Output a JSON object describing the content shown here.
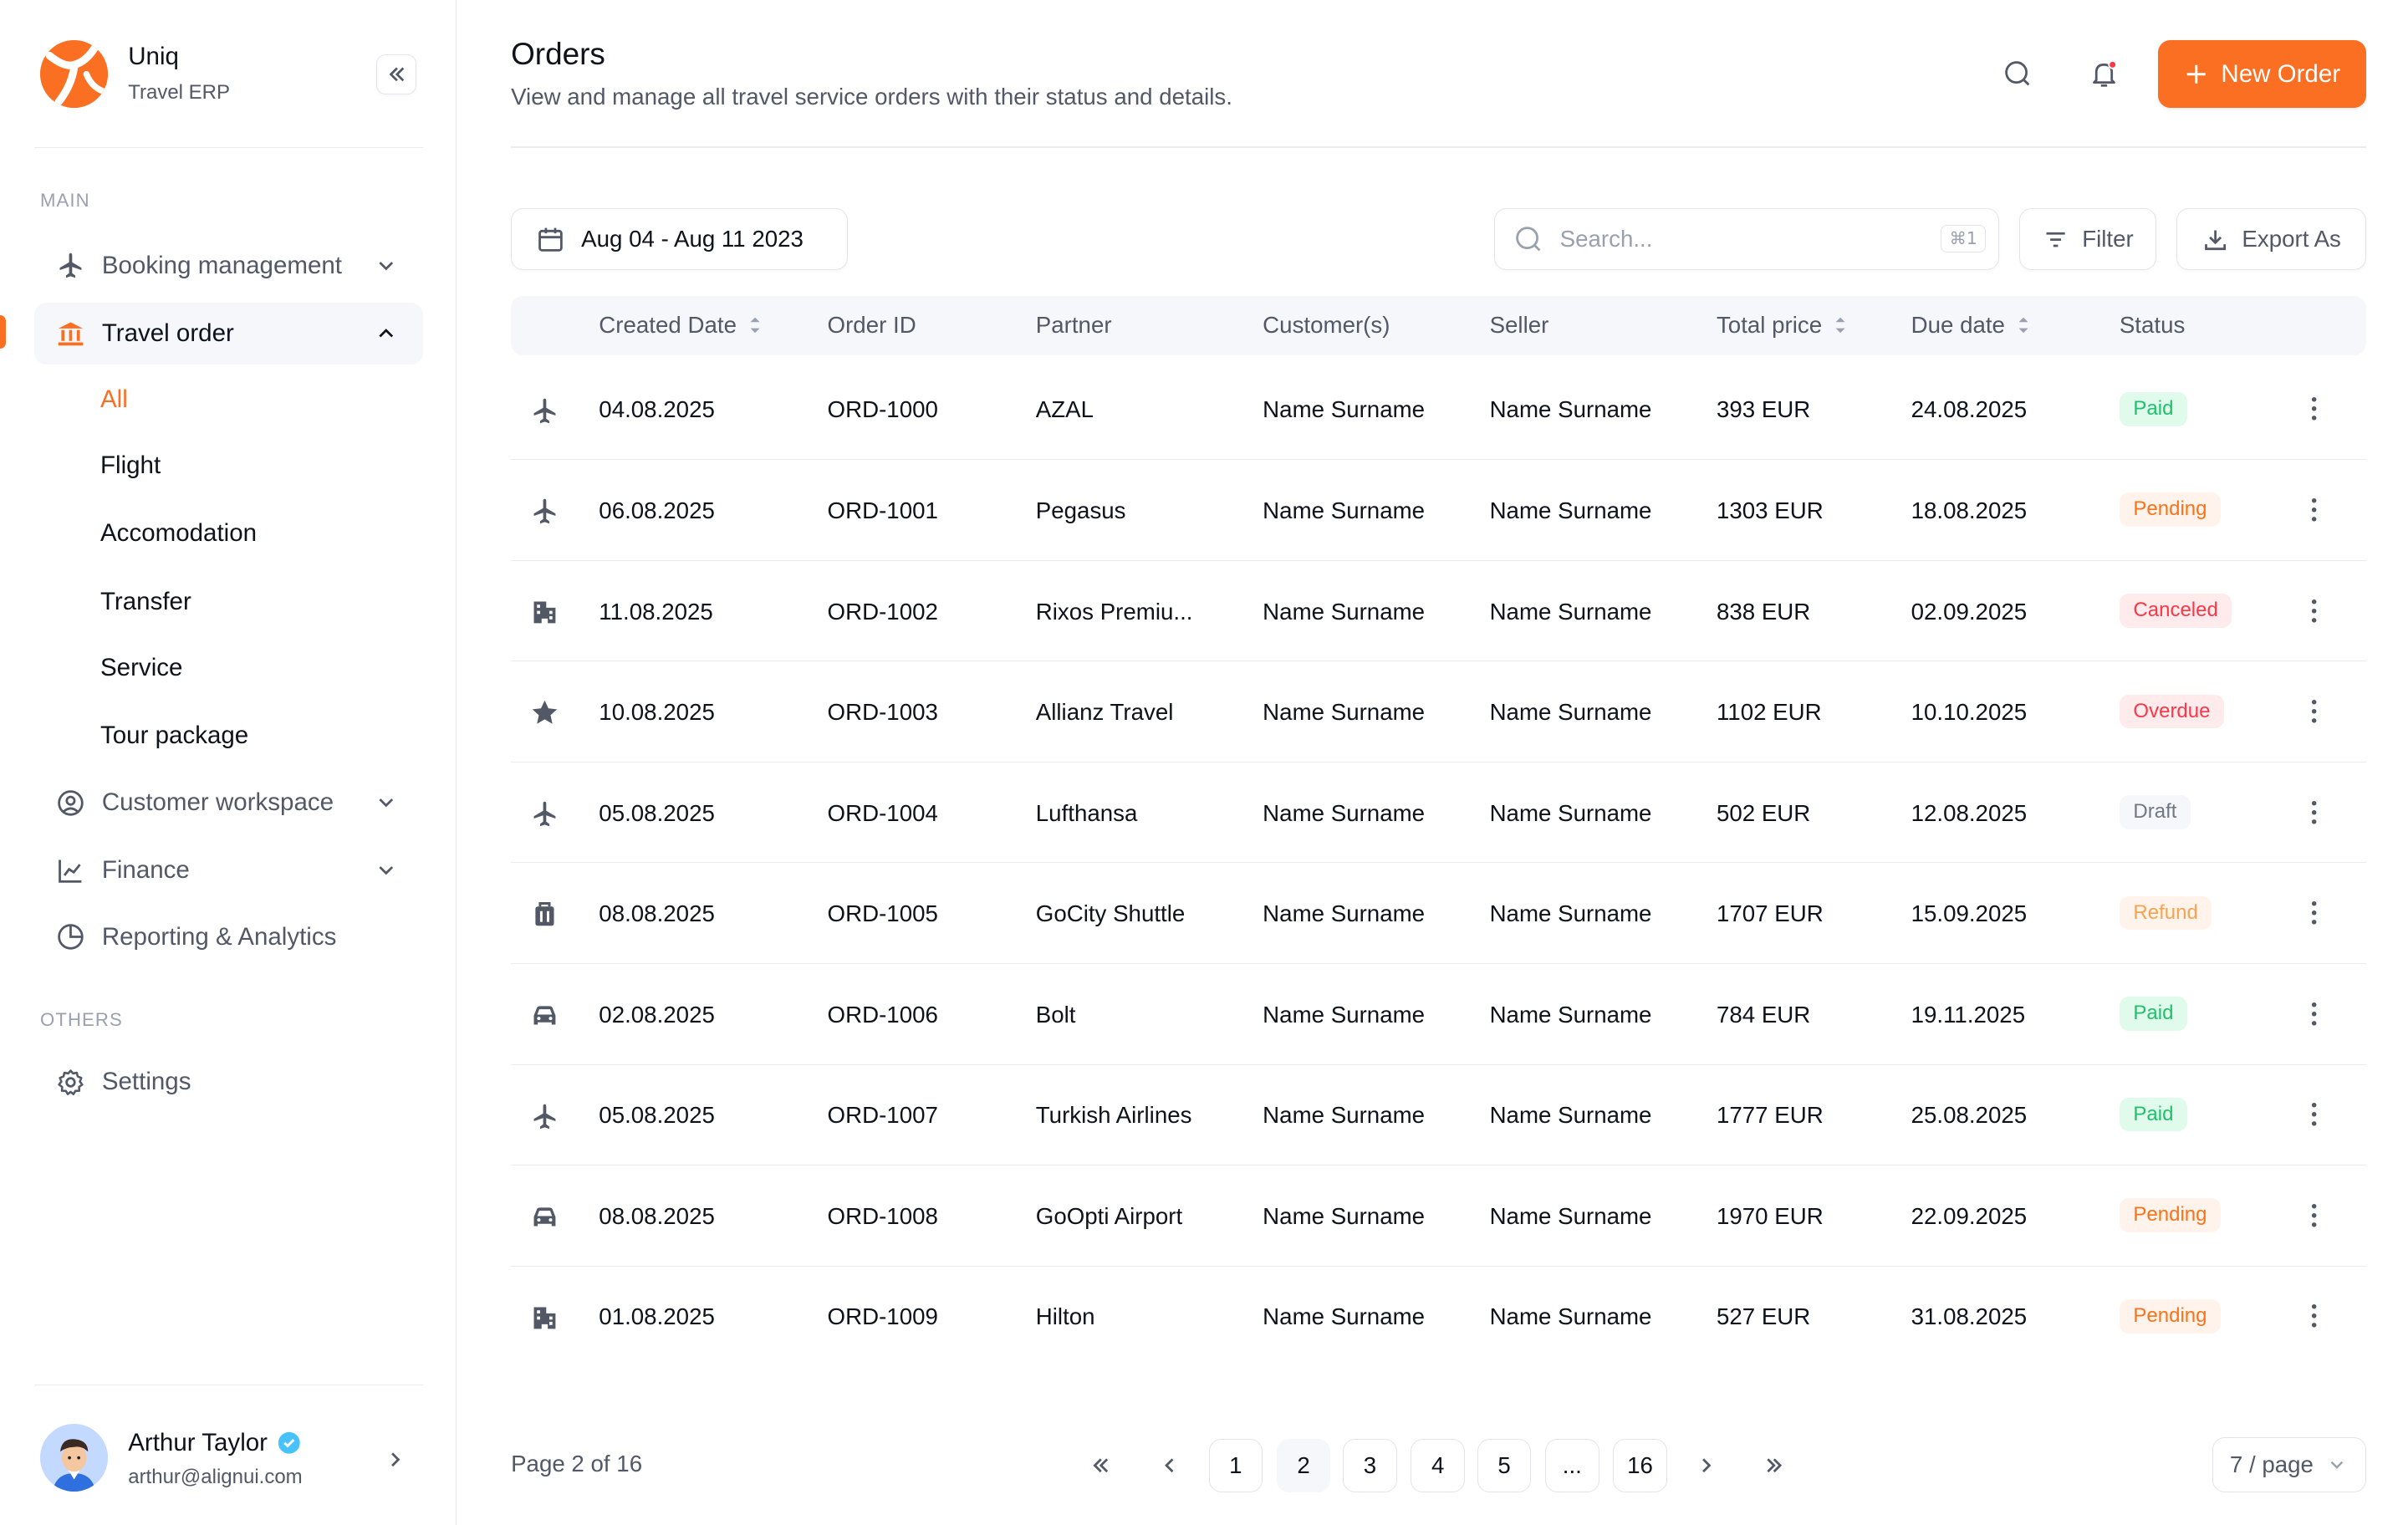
{
  "brand": {
    "name": "Uniq",
    "subtitle": "Travel ERP"
  },
  "sidebar": {
    "main_label": "MAIN",
    "others_label": "OTHERS",
    "items": [
      {
        "label": "Booking management",
        "icon": "plane-icon"
      },
      {
        "label": "Travel order",
        "icon": "building-columns-icon",
        "active": true
      },
      {
        "label": "Customer workspace",
        "icon": "user-circle-icon"
      },
      {
        "label": "Finance",
        "icon": "line-chart-icon"
      },
      {
        "label": "Reporting & Analytics",
        "icon": "pie-chart-icon"
      }
    ],
    "subitems": [
      "All",
      "Flight",
      "Accomodation",
      "Transfer",
      "Service",
      "Tour package"
    ],
    "settings_label": "Settings"
  },
  "user": {
    "name": "Arthur Taylor",
    "email": "arthur@alignui.com"
  },
  "header": {
    "title": "Orders",
    "description": "View and manage all travel service orders with their status and details.",
    "new_order_label": "New Order"
  },
  "toolbar": {
    "date_range": "Aug 04 - Aug 11 2023",
    "search_placeholder": "Search...",
    "search_shortcut": "⌘1",
    "filter_label": "Filter",
    "export_label": "Export As"
  },
  "table": {
    "headers": [
      "Created Date",
      "Order ID",
      "Partner",
      "Customer(s)",
      "Seller",
      "Total price",
      "Due date",
      "Status"
    ],
    "rows": [
      {
        "icon": "plane-icon",
        "created": "04.08.2025",
        "id": "ORD-1000",
        "partner": "AZAL",
        "customer": "Name Surname",
        "seller": "Name Surname",
        "total": "393 EUR",
        "due": "24.08.2025",
        "status": "Paid"
      },
      {
        "icon": "plane-icon",
        "created": "06.08.2025",
        "id": "ORD-1001",
        "partner": "Pegasus",
        "customer": "Name Surname",
        "seller": "Name Surname",
        "total": "1303 EUR",
        "due": "18.08.2025",
        "status": "Pending"
      },
      {
        "icon": "hotel-icon",
        "created": "11.08.2025",
        "id": "ORD-1002",
        "partner": "Rixos Premiu...",
        "customer": "Name Surname",
        "seller": "Name Surname",
        "total": "838 EUR",
        "due": "02.09.2025",
        "status": "Canceled"
      },
      {
        "icon": "star-icon",
        "created": "10.08.2025",
        "id": "ORD-1003",
        "partner": "Allianz Travel",
        "customer": "Name Surname",
        "seller": "Name Surname",
        "total": "1102 EUR",
        "due": "10.10.2025",
        "status": "Overdue"
      },
      {
        "icon": "plane-icon",
        "created": "05.08.2025",
        "id": "ORD-1004",
        "partner": "Lufthansa",
        "customer": "Name Surname",
        "seller": "Name Surname",
        "total": "502 EUR",
        "due": "12.08.2025",
        "status": "Draft"
      },
      {
        "icon": "luggage-icon",
        "created": "08.08.2025",
        "id": "ORD-1005",
        "partner": "GoCity Shuttle",
        "customer": "Name Surname",
        "seller": "Name Surname",
        "total": "1707 EUR",
        "due": "15.09.2025",
        "status": "Refund"
      },
      {
        "icon": "car-icon",
        "created": "02.08.2025",
        "id": "ORD-1006",
        "partner": "Bolt",
        "customer": "Name Surname",
        "seller": "Name Surname",
        "total": "784 EUR",
        "due": "19.11.2025",
        "status": "Paid"
      },
      {
        "icon": "plane-icon",
        "created": "05.08.2025",
        "id": "ORD-1007",
        "partner": "Turkish Airlines",
        "customer": "Name Surname",
        "seller": "Name Surname",
        "total": "1777 EUR",
        "due": "25.08.2025",
        "status": "Paid"
      },
      {
        "icon": "car-icon",
        "created": "08.08.2025",
        "id": "ORD-1008",
        "partner": "GoOpti Airport",
        "customer": "Name Surname",
        "seller": "Name Surname",
        "total": "1970 EUR",
        "due": "22.09.2025",
        "status": "Pending"
      },
      {
        "icon": "hotel-icon",
        "created": "01.08.2025",
        "id": "ORD-1009",
        "partner": "Hilton",
        "customer": "Name Surname",
        "seller": "Name Surname",
        "total": "527 EUR",
        "due": "31.08.2025",
        "status": "Pending"
      }
    ]
  },
  "status_colors": {
    "Paid": {
      "bg": "#e0faec",
      "fg": "#1fc16b"
    },
    "Pending": {
      "bg": "#fff3eb",
      "fg": "#fa7319"
    },
    "Canceled": {
      "bg": "#ffebec",
      "fg": "#fb3748"
    },
    "Overdue": {
      "bg": "#ffebec",
      "fg": "#fb3748"
    },
    "Draft": {
      "bg": "#f5f7fa",
      "fg": "#717784"
    },
    "Refund": {
      "bg": "#fff3eb",
      "fg": "#f6a350"
    }
  },
  "pagination": {
    "info": "Page 2 of 16",
    "pages": [
      "1",
      "2",
      "3",
      "4",
      "5",
      "...",
      "16"
    ],
    "current": "2",
    "per_page": "7 / page"
  },
  "colors": {
    "accent": "#fb6f23",
    "text": "#0e121b",
    "muted": "#525866",
    "border": "#e1e4ea"
  }
}
